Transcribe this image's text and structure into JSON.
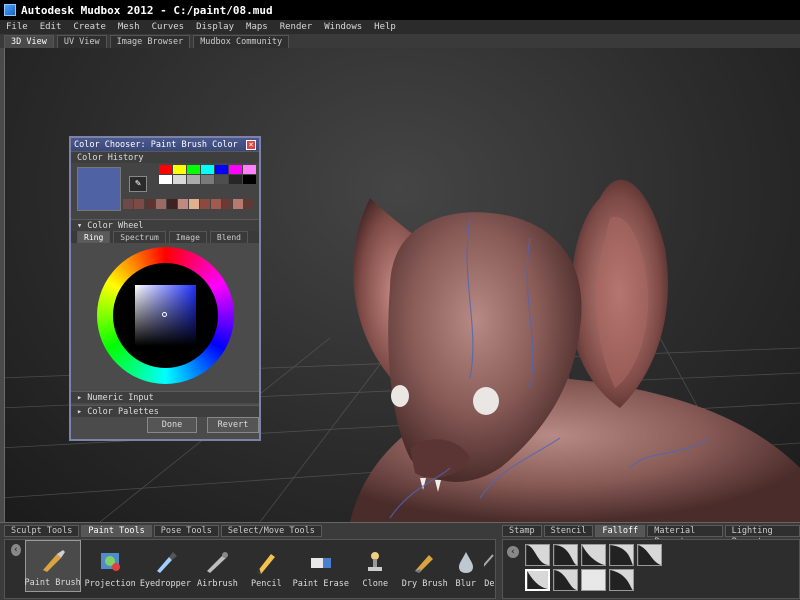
{
  "window": {
    "title": "Autodesk Mudbox 2012 - C:/paint/08.mud"
  },
  "menu": [
    "File",
    "Edit",
    "Create",
    "Mesh",
    "Curves",
    "Display",
    "Maps",
    "Render",
    "Windows",
    "Help"
  ],
  "top_tabs": [
    "3D View",
    "UV View",
    "Image Browser",
    "Mudbox Community"
  ],
  "dialog": {
    "title": "Color Chooser: Paint Brush Color",
    "color_history_label": "Color History",
    "current_color": "#4f62a3",
    "color_wheel_label": "Color Wheel",
    "wheel_tabs": [
      "Ring",
      "Spectrum",
      "Image",
      "Blend"
    ],
    "numeric_input_label": "Numeric Input",
    "color_palettes_label": "Color Palettes",
    "done_label": "Done",
    "revert_label": "Revert"
  },
  "bottom_tabs": [
    "Sculpt Tools",
    "Paint Tools",
    "Pose Tools",
    "Select/Move Tools"
  ],
  "tools": [
    {
      "label": "Paint Brush",
      "icon": "paint-brush-icon"
    },
    {
      "label": "Projection",
      "icon": "projection-icon"
    },
    {
      "label": "Eyedropper",
      "icon": "eyedropper-icon"
    },
    {
      "label": "Airbrush",
      "icon": "airbrush-icon"
    },
    {
      "label": "Pencil",
      "icon": "pencil-icon"
    },
    {
      "label": "Paint Erase",
      "icon": "eraser-icon"
    },
    {
      "label": "Clone",
      "icon": "clone-stamp-icon"
    },
    {
      "label": "Dry Brush",
      "icon": "dry-brush-icon"
    },
    {
      "label": "Blur",
      "icon": "blur-drop-icon"
    },
    {
      "label": "De",
      "icon": "partial-tool-icon"
    }
  ],
  "right_tabs": [
    "Stamp",
    "Stencil",
    "Falloff",
    "Material Presets",
    "Lighting Presets"
  ]
}
